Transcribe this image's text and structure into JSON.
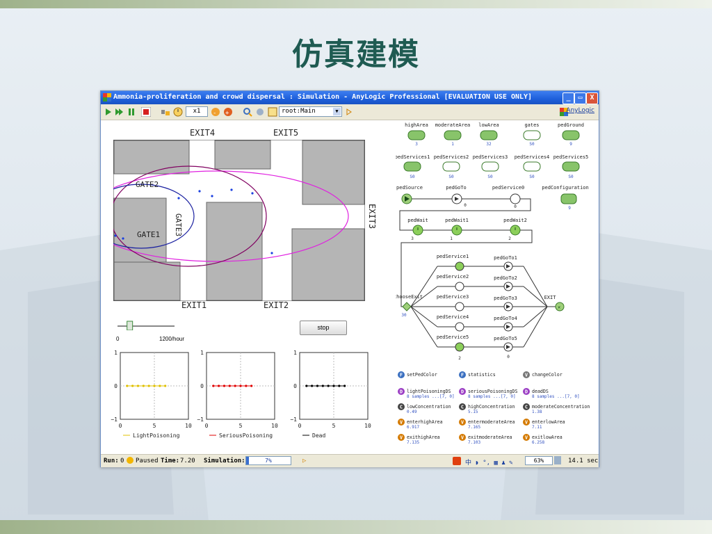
{
  "slide_title": "仿真建模",
  "window": {
    "title": "Ammonia-proliferation and crowd dispersal : Simulation - AnyLogic Professional [EVALUATION USE ONLY]",
    "brand": "AnyLogic",
    "controls": {
      "minimize": "_",
      "maximize": "▭",
      "close": "X"
    }
  },
  "toolbar": {
    "speed": "x1",
    "model_select": "root:Main",
    "buttons": [
      "run",
      "run-until",
      "pause",
      "stop",
      "step",
      "speed-down",
      "speed-up",
      "zoom",
      "refresh",
      "tree",
      "select",
      "play-marker"
    ]
  },
  "map": {
    "exits": [
      "EXIT4",
      "EXIT5",
      "EXIT1",
      "EXIT2",
      "EXIT3"
    ],
    "gates": [
      "GATE2",
      "GATE3",
      "GATE1"
    ]
  },
  "slider": {
    "min_label": "0",
    "max_label": "1200/hour",
    "value_fraction": 0.18
  },
  "stop_button": "stop",
  "charts": {
    "yticks": [
      "1",
      "0",
      "−1"
    ],
    "xticks": [
      "0",
      "5",
      "10"
    ]
  },
  "chart_data": [
    {
      "type": "line",
      "series": [
        {
          "name": "LightPoisoning",
          "color": "#e0c000",
          "x": [
            1,
            1.8,
            2.6,
            3.4,
            4.2,
            5,
            5.8,
            6.6
          ],
          "y": [
            0,
            0,
            0,
            0,
            0,
            0,
            0,
            0
          ]
        }
      ],
      "xlim": [
        0,
        10
      ],
      "ylim": [
        -1,
        1
      ],
      "grid": true,
      "legend": "bottom"
    },
    {
      "type": "line",
      "series": [
        {
          "name": "SeriousPoisoning",
          "color": "#e00000",
          "x": [
            1,
            1.8,
            2.6,
            3.4,
            4.2,
            5,
            5.8,
            6.6
          ],
          "y": [
            0,
            0,
            0,
            0,
            0,
            0,
            0,
            0
          ]
        }
      ],
      "xlim": [
        0,
        10
      ],
      "ylim": [
        -1,
        1
      ],
      "grid": true,
      "legend": "bottom"
    },
    {
      "type": "line",
      "series": [
        {
          "name": "Dead",
          "color": "#000000",
          "x": [
            1,
            1.8,
            2.6,
            3.4,
            4.2,
            5,
            5.8,
            6.6
          ],
          "y": [
            0,
            0,
            0,
            0,
            0,
            0,
            0,
            0
          ]
        }
      ],
      "xlim": [
        0,
        10
      ],
      "ylim": [
        -1,
        1
      ],
      "grid": true,
      "legend": "bottom"
    }
  ],
  "areas": [
    {
      "label": "highArea",
      "count": "3"
    },
    {
      "label": "moderateArea",
      "count": "1"
    },
    {
      "label": "lowArea",
      "count": "32"
    },
    {
      "label": "gates",
      "count": "S0"
    },
    {
      "label": "pedGround",
      "count": "9"
    }
  ],
  "services": [
    {
      "label": "pedServices1",
      "count": "S0"
    },
    {
      "label": "pedServices2",
      "count": "S0"
    },
    {
      "label": "pedServices3",
      "count": "S0"
    },
    {
      "label": "pedServices4",
      "count": "S0"
    },
    {
      "label": "pedServices5",
      "count": "S0"
    }
  ],
  "flow": {
    "row1": [
      "pedSource",
      "pedGoTo",
      "pedService0",
      "pedConfiguration"
    ],
    "row2": [
      "pedWait",
      "pedWait1",
      "pedWait2"
    ],
    "choose": "chooseExit",
    "exit": "EXIT",
    "branches": [
      {
        "service": "pedService1",
        "goto": "pedGoTo1"
      },
      {
        "service": "pedService2",
        "goto": "pedGoTo2"
      },
      {
        "service": "pedService3",
        "goto": "pedGoTo3"
      },
      {
        "service": "pedService4",
        "goto": "pedGoTo4"
      },
      {
        "service": "pedService5",
        "goto": "pedGoTo5"
      }
    ],
    "counts": {
      "r1a": "0",
      "r1b": "0",
      "r2a": "3",
      "r2b": "1",
      "r2c": "2",
      "exit_in": "30",
      "bottom": "2",
      "bottom2": "0"
    }
  },
  "variables": [
    {
      "badge": "F",
      "label": "setPedColor",
      "color": "#3a6fc0"
    },
    {
      "badge": "F",
      "label": "statistics",
      "color": "#3a6fc0"
    },
    {
      "badge": "V",
      "label": "changeColor",
      "color": "#777777"
    },
    {
      "badge": "D",
      "label": "lightPoisoningDS",
      "value": "8 samples ...[7, 0]",
      "color": "#9b3fc4"
    },
    {
      "badge": "D",
      "label": "seriousPoisoningDS",
      "value": "8 samples ...[7, 0]",
      "color": "#9b3fc4"
    },
    {
      "badge": "D",
      "label": "deadDS",
      "value": "8 samples ...[7, 0]",
      "color": "#9b3fc4"
    },
    {
      "badge": "C",
      "label": "lowConcentration",
      "value": "0.49",
      "color": "#444444"
    },
    {
      "badge": "C",
      "label": "highConcentration",
      "value": "5.15",
      "color": "#444444"
    },
    {
      "badge": "C",
      "label": "moderateConcentration",
      "value": "1.38",
      "color": "#444444"
    },
    {
      "badge": "V",
      "label": "enterhighArea",
      "value": "6.917",
      "color": "#d47a00"
    },
    {
      "badge": "V",
      "label": "entermoderateArea",
      "value": "7.165",
      "color": "#d47a00"
    },
    {
      "badge": "V",
      "label": "enterlowArea",
      "value": "7.11",
      "color": "#d47a00"
    },
    {
      "badge": "V",
      "label": "exithighArea",
      "value": "7.135",
      "color": "#d47a00"
    },
    {
      "badge": "V",
      "label": "exitmoderateArea",
      "value": "7.103",
      "color": "#d47a00"
    },
    {
      "badge": "V",
      "label": "exitlowArea",
      "value": "6.258",
      "color": "#d47a00"
    }
  ],
  "status": {
    "run_label": "Run:",
    "run_value": "0",
    "state": "Paused",
    "time_label": "Time:",
    "time_value": "7.20",
    "sim_label": "Simulation:",
    "sim_progress": "7%",
    "sim_progress_fraction": 0.07,
    "zoom": "63%",
    "elapsed": "14.1 sec"
  }
}
